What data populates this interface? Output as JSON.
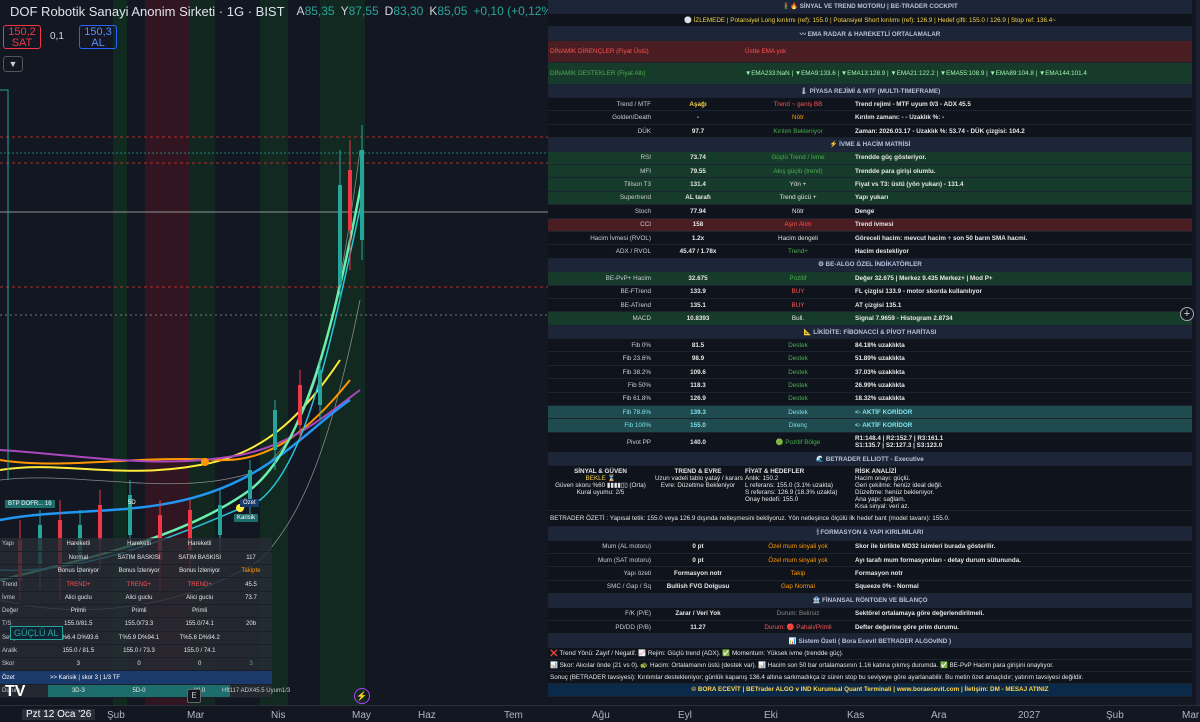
{
  "header": {
    "title": "DOF Robotik Sanayi Anonim Sirketi · 1G · BIST",
    "open_label": "A",
    "open": "85,35",
    "high_label": "Y",
    "high": "87,55",
    "low_label": "D",
    "low": "83,30",
    "close_label": "K",
    "close": "85,05",
    "change": "+0,10 (+0,12%)"
  },
  "trade": {
    "sell_price": "150,2",
    "sell_label": "SAT",
    "spread": "0,1",
    "buy_price": "150,3",
    "buy_label": "AL",
    "collapse_icon": "chevron-down-icon"
  },
  "cockpit": {
    "title": "🚦🔥 SİNYAL VE TREND MOTORU | BE-TRADER COCKPIT",
    "status": "⚪ İZLEMEDE | Potansiyel Long kırılımı (ref): 155.0 | Potansiyel Short kırılımı (ref): 126.9 | Hedef çifti: 155.0 / 126.9 | Stop ref: 136.4~",
    "ema_title": "〰 EMA RADAR & HAREKETLİ ORTALAMALAR",
    "res_label": "DİNAMİK DİRENÇLER (Fiyat Üstü)",
    "res_value": "Üstte EMA yok",
    "sup_label": "DİNAMİK DESTEKLER (Fiyat Altı)",
    "sup_value": "▼EMA233:NaN | ▼EMA9:133.6 | ▼EMA13:128.9 | ▼EMA21:122.2 | ▼EMA55:108.9 | ▼EMA89:104.8 | ▼EMA144:101.4",
    "regime_title": "🌡 PİYASA REJİMİ & MTF (MULTI-TIMEFRAME)",
    "regime_rows": [
      {
        "a": "Trend / MTF",
        "b": "Aşağı",
        "c": "Trend ~ geniş BB",
        "d": "Trend rejimi - MTF uyum 0/3 - ADX 45.5"
      },
      {
        "a": "Golden/Death",
        "b": "-",
        "c": "Nötr",
        "d": "Kırılım zamanı: - - Uzaklık %: -"
      },
      {
        "a": "DÜK",
        "b": "97.7",
        "c": "Kırılım Bekleniyor",
        "d": "Zaman: 2026.03.17 - Uzaklık %: 53.74 - DÜK çizgisi: 104.2"
      }
    ],
    "momentum_title": "⚡ İVME & HACİM MATRİSİ",
    "momentum_rows": [
      {
        "a": "RSI",
        "b": "73.74",
        "c": "Güçlü Trend / İvme",
        "d": "Trendde güç gösteriyor."
      },
      {
        "a": "MFI",
        "b": "79.55",
        "c": "Akış güçlü (trend)",
        "d": "Trendde para girişi olumlu."
      },
      {
        "a": "Tillson T3",
        "b": "131.4",
        "c": "Yön +",
        "d": "Fiyat vs T3: üstü (yön yukarı) - 131.4"
      },
      {
        "a": "Supertrend",
        "b": "AL tarafı",
        "c": "Trend gücü +",
        "d": "Yapı yukarı"
      },
      {
        "a": "Stoch",
        "b": "77.94",
        "c": "Nötr",
        "d": "Denge"
      },
      {
        "a": "CCI",
        "b": "158",
        "c": "Aşırı Alım",
        "d": "Trend ivmesi"
      },
      {
        "a": "Hacim İvmesi (RVOL)",
        "b": "1.2x",
        "c": "Hacim dengeli",
        "d": "Göreceli hacim: mevcut hacim ÷ son 50 barın SMA hacmi."
      },
      {
        "a": "ADX / RVOL",
        "b": "45.47 / 1.78x",
        "c": "Trend+",
        "d": "Hacim destekliyor"
      }
    ],
    "algo_title": "⚙ BE-ALGO ÖZEL İNDİKATÖRLER",
    "algo_rows": [
      {
        "a": "BE-PvP+ Hacim",
        "b": "32.675",
        "c": "Pozitif",
        "d": "Değer 32.675 | Merkez 9.435 Merkez+ | Mod P+"
      },
      {
        "a": "BE-FTrend",
        "b": "133.9",
        "c": "BUY",
        "d": "FL çizgisi 133.9 - motor skorda kullanılıyor"
      },
      {
        "a": "BE-ATrend",
        "b": "135.1",
        "c": "BUY",
        "d": "AT çizgisi 135.1"
      },
      {
        "a": "MACD",
        "b": "10.8393",
        "c": "Bull.",
        "d": "Signal 7.9659 - Histogram 2.8734"
      }
    ],
    "fib_title": "📐 LİKİDİTE: FİBONACCİ & PİVOT HARİTASI",
    "fib_rows": [
      {
        "a": "Fib 0%",
        "b": "81.5",
        "c": "Destek",
        "d": "84.18% uzaklıkta"
      },
      {
        "a": "Fib 23.6%",
        "b": "98.9",
        "c": "Destek",
        "d": "51.89% uzaklıkta"
      },
      {
        "a": "Fib 38.2%",
        "b": "109.6",
        "c": "Destek",
        "d": "37.03% uzaklıkta"
      },
      {
        "a": "Fib 50%",
        "b": "118.3",
        "c": "Destek",
        "d": "26.99% uzaklıkta"
      },
      {
        "a": "Fib 61.8%",
        "b": "126.9",
        "c": "Destek",
        "d": "18.32% uzaklıkta"
      },
      {
        "a": "Fib 78.6%",
        "b": "139.3",
        "c": "Destek",
        "d": "<- AKTİF KORİDOR"
      },
      {
        "a": "Fib 100%",
        "b": "155.0",
        "c": "Direnç",
        "d": "<- AKTİF KORİDOR"
      }
    ],
    "pivot": {
      "a": "Pivot PP",
      "b": "140.0",
      "c": "🟢 Pozitif Bölge",
      "d1": "R1:148.4 | R2:152.7 | R3:161.1",
      "d2": "S1:135.7 | S2:127.3 | S3:123.0"
    },
    "elliott_title": "🌊 BETRADER ELLIOTT - Executive",
    "elliott": {
      "c1": [
        "SİNYAL & GÜVEN",
        "BEKLE ⌛",
        "Güven skoru %60 ▮▮▮▮▯▯ (Orta)",
        "Kural uyumu: 2/5"
      ],
      "c2": [
        "TREND & EVRE",
        "Uzun vadeli tablo yataý / kararsız.",
        "Evre: Düzeltme Bekleniyor"
      ],
      "c3": [
        "FİYAT & HEDEFLER",
        "Anlık: 150.2",
        "L referans: 155.0 (3.1% uzakta)",
        "S referans: 126.9 (18.3% uzakta)",
        "Onay hedefi: 155.0"
      ],
      "c4": [
        "RİSK ANALİZİ",
        "Hacim onayı: güçlü.",
        "Geri çekilme: henüz ideal değil.",
        "Düzeltme: henüz bekleniyor.",
        "Ana yapı: sağlam.",
        "Kısa sinyal: veri az."
      ]
    },
    "summary": "BETRADER ÖZETİ : Yapısal tetik: 155.0 veya 126.9 dışında netleşmesini bekliyoruz. Yön netleşince ölçülü ilk hedef bant (model tavanı): 155.0.",
    "form_title": "🕯 FORMASYON & YAPI KIRILIMLARI",
    "form_rows": [
      {
        "a": "Mum (AL motoru)",
        "b": "0 pt",
        "c": "Özel mum sinyali yok",
        "d": "Skor ile birlikte MD32 isimleri burada gösterilir."
      },
      {
        "a": "Mum (SAT motoru)",
        "b": "0 pt",
        "c": "Özel mum sinyali yok",
        "d": "Ayı tarafı mum formasyonları - detay durum sütununda."
      },
      {
        "a": "Yapı özeti",
        "b": "Formasyon notr",
        "c": "Takip",
        "d": "Formasyon notr"
      },
      {
        "a": "SMC / Gap / Sq",
        "b": "Bullish FVG Dolgusu",
        "c": "Gap Normal",
        "d": "Squeeze 0% - Normal"
      }
    ],
    "fin_title": "🏦 FİNANSAL RÖNTGEN VE BİLANÇO",
    "fin_rows": [
      {
        "a": "F/K (P/E)",
        "b": "Zarar / Veri Yok",
        "c": "Durum: Belirsiz",
        "d": "Sektörel ortalamaya göre değerlendirilmeli."
      },
      {
        "a": "PD/DD (P/B)",
        "b": "11.27",
        "c": "Durum: 🔴 Pahalı/Primli",
        "d": "Defter değerine göre prim durumu."
      }
    ],
    "sys_title": "📊 Sistem Özeti ( Bora Ecevit BETRADER ALGOvIND )",
    "notes": [
      "❌ Trend Yönü: Zayıf / Negatif. 📈 Rejim: Güçlü trend (ADX). ✅ Momentum: Yüksek ivme (trendde güç).",
      "📊 Skor: Alıcılar önde (21 vs 0). 🐢 Hacim: Ortalamanın üstü (destek var). 📊 Hacim son 50 bar ortalamasının 1.16 katına çıkmış durumda. ✅ BE-PvP Hacim para girişini onaylıyor.",
      "Sonuç (BETRADER tavsiyesi): Kırılımlar destekleniyor; günlük kapanış 136.4 altına sarkmadıkça iz süren stop bu seviyeye göre ayarlanabilir. Bu metin özet amaçlıdır; yatırım tavsiyesi değildir."
    ],
    "footer": "© BORA ECEVİT | BETrader ALGO v IND Kurumsal Quant Terminali | www.boraecevit.com | İletişim: DM - MESAJ ATINIZ"
  },
  "score_quick": {
    "a": "BTP DOFR...  16",
    "b": "5D",
    "c": "Özet",
    "d": "Karisik"
  },
  "score": {
    "rows": [
      {
        "l": "Yapı",
        "v": [
          "Hareketli",
          "Hareketli",
          "Hareketli",
          ""
        ]
      },
      {
        "l": "",
        "v": [
          "Normal",
          "SATIM BASKISI",
          "SATIM BASKISI",
          "117"
        ]
      },
      {
        "l": "",
        "v": [
          "Bonus İzleniyor",
          "Bonus İzleniyor",
          "Bonus İzleniyor",
          "Takipte"
        ]
      },
      {
        "l": "Trend",
        "v": [
          "TREND+",
          "TREND+",
          "TREND+",
          "45.5"
        ]
      },
      {
        "l": "İvme",
        "v": [
          "Alici guclu",
          "Alici guclu",
          "Alici guclu",
          "73.7"
        ]
      },
      {
        "l": "Değer",
        "v": [
          "Primli",
          "Primli",
          "Primli",
          ""
        ]
      },
      {
        "l": "T/S",
        "v": [
          "155.0/81.5",
          "155.0/73.3",
          "155.0/74.1",
          "20b"
        ]
      },
      {
        "l": "Seviye",
        "v": [
          "T%6.4 D%93.6",
          "T%5.9 D%94.1",
          "T%5.8 D%94.2",
          ""
        ]
      },
      {
        "l": "Aralik",
        "v": [
          "155.0 / 81.5",
          "155.0 / 73.3",
          "155.0 / 74.1",
          ""
        ]
      },
      {
        "l": "Skor",
        "v": [
          "3",
          "0",
          "0",
          "3"
        ]
      }
    ],
    "ozet_label": "Özet",
    "ozet_value": ">> Karisik | skor 3 | 1/3 TF",
    "durum_label": "Durum",
    "durum_v": [
      "3D-3",
      "5D-0",
      "W-0"
    ]
  },
  "guclu": "GÜÇLÜ AL",
  "status_line": "Hft117 ADX45.5 Uyum1/3",
  "x_axis": {
    "current": "Pzt 12 Oca '26",
    "labels": [
      "Şub",
      "Mar",
      "Nis",
      "May",
      "Haz",
      "Tem",
      "Ağu",
      "Eyl",
      "Eki",
      "Kas",
      "Ara",
      "2027",
      "Şub",
      "Mar"
    ]
  }
}
